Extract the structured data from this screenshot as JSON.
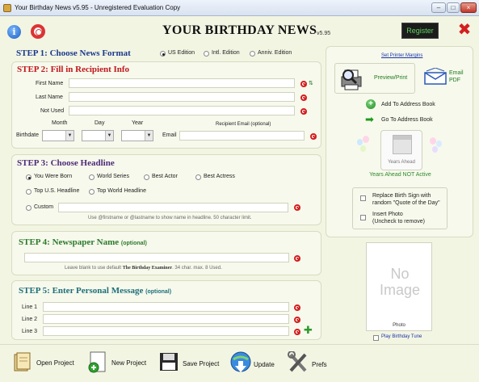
{
  "window": {
    "title": "Your Birthday News v5.95 - Unregistered Evaluation Copy",
    "minimize": "–",
    "maximize": "□",
    "close": "×"
  },
  "header": {
    "app_title": "YOUR BIRTHDAY NEWS",
    "version": "v5.95",
    "register_label": "Register"
  },
  "step1": {
    "title": "STEP 1: Choose News Format",
    "options": [
      "US Edition",
      "Intl. Edition",
      "Anniv. Edition"
    ],
    "selected": "US Edition"
  },
  "step2": {
    "title": "STEP 2: Fill in Recipient Info",
    "first_name_label": "First Name",
    "last_name_label": "Last Name",
    "not_used_label": "Not Used",
    "birthdate_label": "Birthdate",
    "month_label": "Month",
    "day_label": "Day",
    "year_label": "Year",
    "email_label": "Email",
    "recipient_email_label": "Recipient Email (optional)"
  },
  "step3": {
    "title": "STEP 3: Choose Headline",
    "options": [
      "You Were Born",
      "World Series",
      "Best Actor",
      "Best Actress",
      "Top U.S. Headline",
      "Top World Headline",
      "Custom"
    ],
    "selected": "You Were Born",
    "hint": "Use @firstname or @lastname to show name in headline. 50 character limit."
  },
  "step4": {
    "title": "STEP 4: Newspaper Name",
    "optional": "(optional)",
    "hint_prefix": "Leave blank to use default",
    "hint_name": "The Birthday Examiner",
    "hint_suffix": ". 34 char. max. 8 Used."
  },
  "step5": {
    "title": "STEP 5: Enter Personal Message",
    "optional": "(optional)",
    "lines": [
      "Line 1",
      "Line 2",
      "Line 3"
    ]
  },
  "sidebar": {
    "printer_margins": "Set Printer Margins",
    "preview_print": "Preview/Print",
    "email_pdf_line1": "Email",
    "email_pdf_line2": "PDF",
    "add_to_address_book": "Add To Address Book",
    "go_to_address_book": "Go To Address Book",
    "years_ahead": "Years Ahead",
    "years_ahead_status": "Years Ahead NOT Active",
    "replace_sign_line1": "Replace Birth Sign with",
    "replace_sign_line2": "random \"Quote of the Day\"",
    "insert_photo_line1": "Insert Photo",
    "insert_photo_line2": "(Uncheck to remove)",
    "no_image_line1": "No",
    "no_image_line2": "Image",
    "photo_label": "Photo",
    "play_tune": "Play Birthday Tune"
  },
  "toolbar": {
    "open_project": "Open Project",
    "new_project": "New Project",
    "save_project": "Save Project",
    "update": "Update",
    "prefs": "Prefs"
  },
  "colors": {
    "step_blue": "#1b3a8c",
    "step_red": "#c0171d",
    "step_purple": "#4e2b7a",
    "step_green": "#2b7a2b",
    "step_teal": "#1d6f7a",
    "accent_green": "#5fd05f",
    "error_red": "#d21d1d"
  }
}
